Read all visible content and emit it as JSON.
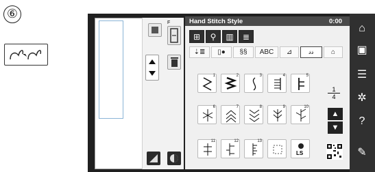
{
  "step": {
    "number": "⑥"
  },
  "screen": {
    "title": "Hand Stitch Style",
    "time": "0:00"
  },
  "preview_tools": {
    "f_label": "F"
  },
  "category_tabs": [
    "abc_label"
  ],
  "tabs": {
    "abc": "ABC"
  },
  "stitch_grid": {
    "numbers": [
      "1",
      "2",
      "3",
      "4",
      "5",
      "6",
      "7",
      "8",
      "9",
      "10",
      "11",
      "12",
      "13"
    ],
    "ls_label": "LS"
  },
  "width_adjust": {
    "numerator": "1",
    "denominator": "4"
  },
  "colors": {
    "screen_bg": "#202020",
    "panel_bg": "#f0f0f0",
    "sidebar_bg": "#303030"
  }
}
